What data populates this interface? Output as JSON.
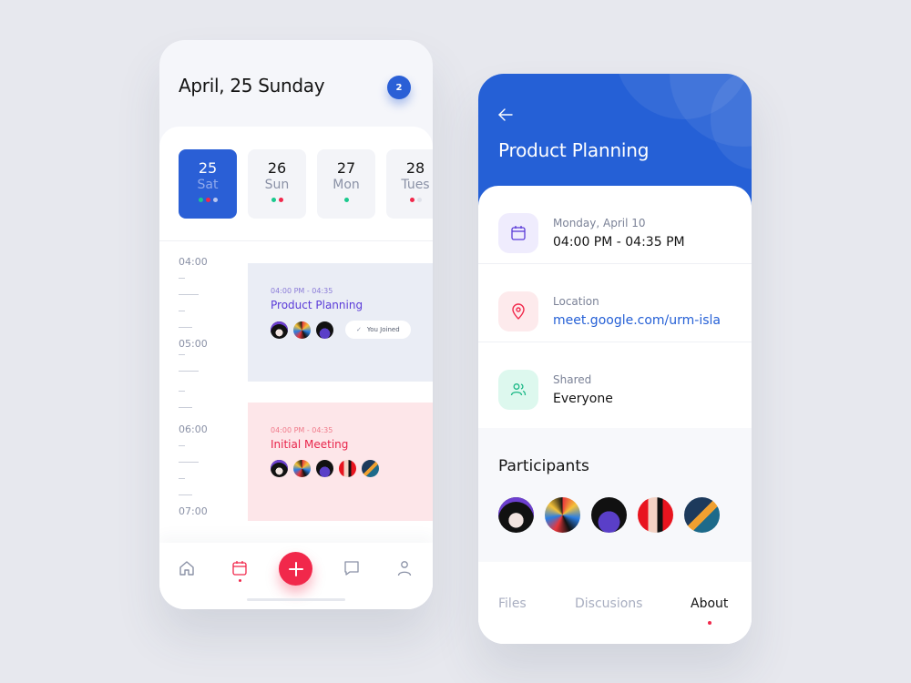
{
  "left_screen": {
    "title": "April, 25 Sunday",
    "notification_count": "2",
    "days": [
      {
        "num": "25",
        "name": "Sat",
        "active": true,
        "dots": [
          "#1bc98e",
          "#f1284b",
          "#b9c6f0"
        ]
      },
      {
        "num": "26",
        "name": "Sun",
        "active": false,
        "dots": [
          "#1bc98e",
          "#f1284b"
        ]
      },
      {
        "num": "27",
        "name": "Mon",
        "active": false,
        "dots": [
          "#1bc98e"
        ]
      },
      {
        "num": "28",
        "name": "Tues",
        "active": false,
        "dots": [
          "#f1284b",
          "#dfe2ea"
        ]
      }
    ],
    "time_labels": [
      "04:00",
      "05:00",
      "06:00",
      "07:00"
    ],
    "events": [
      {
        "time": "04:00 PM - 04:35",
        "title": "Product Planning",
        "joined_label": "You Joined",
        "avatar_count": 3
      },
      {
        "time": "04:00 PM - 04:35",
        "title": "Initial Meeting",
        "avatar_count": 5
      }
    ],
    "nav": [
      {
        "icon": "home-icon"
      },
      {
        "icon": "calendar-icon",
        "active": true
      },
      {
        "icon": "plus-icon"
      },
      {
        "icon": "chat-icon"
      },
      {
        "icon": "user-icon"
      }
    ]
  },
  "right_screen": {
    "title": "Product Planning",
    "details": [
      {
        "icon": "calendar-icon",
        "label": "Monday, April 10",
        "value": "04:00 PM - 04:35 PM"
      },
      {
        "icon": "location-pin-icon",
        "label": "Location",
        "value": "meet.google.com/urm-isla"
      },
      {
        "icon": "users-icon",
        "label": "Shared",
        "value": "Everyone"
      }
    ],
    "participants_title": "Participants",
    "tabs": [
      {
        "label": "Files",
        "active": false
      },
      {
        "label": "Discusions",
        "active": false
      },
      {
        "label": "About",
        "active": true
      }
    ]
  },
  "colors": {
    "primary_blue": "#2560d6",
    "accent_red": "#f1284b",
    "green": "#1bc98e",
    "purple": "#5a3bd8"
  }
}
